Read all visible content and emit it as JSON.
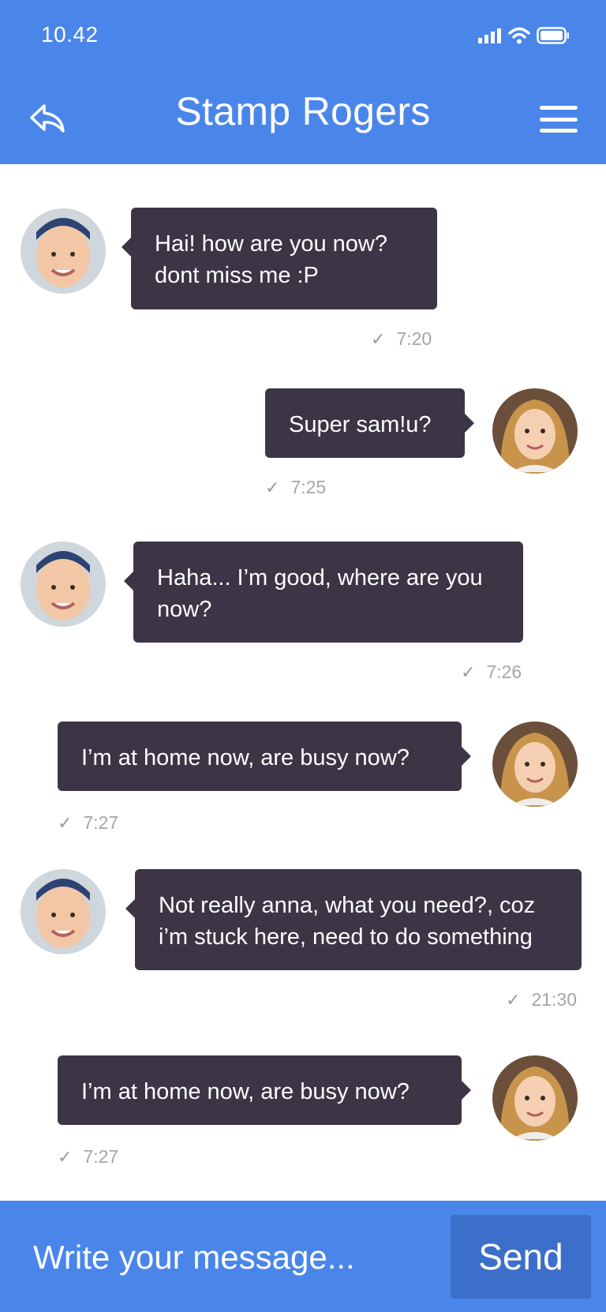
{
  "status_bar": {
    "time": "10.42"
  },
  "header": {
    "title": "Stamp Rogers"
  },
  "messages": [
    {
      "sender": "boy",
      "side": "left",
      "text": "Hai! how are you now?\ndont miss me :P",
      "time": "7:20"
    },
    {
      "sender": "girl",
      "side": "right",
      "text": "Super sam!u?",
      "time": "7:25"
    },
    {
      "sender": "boy",
      "side": "left",
      "text": "Haha... I’m good, where are you now?",
      "time": "7:26"
    },
    {
      "sender": "girl",
      "side": "right",
      "text": "I’m at home now, are busy now?",
      "time": "7:27"
    },
    {
      "sender": "boy",
      "side": "left",
      "text": "Not really anna, what you need?, coz i’m stuck here, need to do something",
      "time": "21:30"
    },
    {
      "sender": "girl",
      "side": "right",
      "text": "I’m at home now, are busy now?",
      "time": "7:27"
    }
  ],
  "composer": {
    "placeholder": "Write your message...",
    "send_label": "Send"
  },
  "icons": {
    "back": "reply-icon",
    "menu": "hamburger-icon",
    "check": "check-icon"
  },
  "colors": {
    "primary": "#4a86ea",
    "bubble": "#3d3545",
    "send_button": "#3c6fc9",
    "meta_text": "#a5a5a5"
  }
}
